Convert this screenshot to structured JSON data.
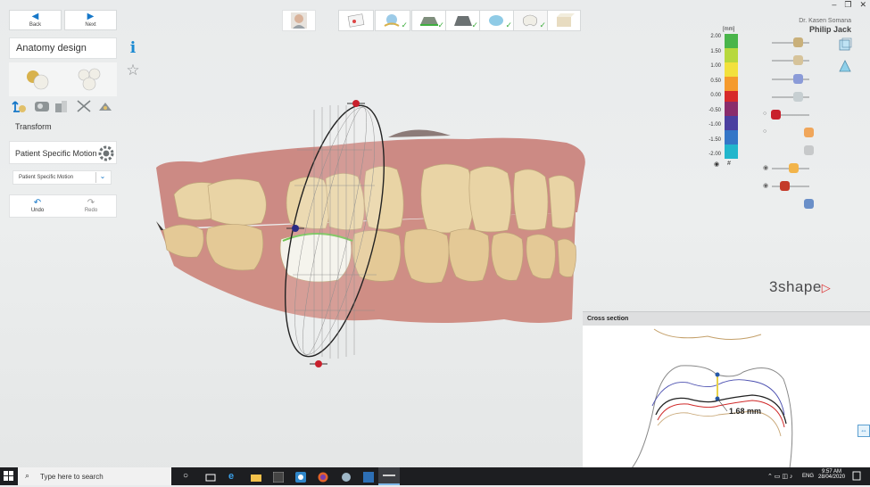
{
  "window": {
    "minimize": "–",
    "restore": "❐",
    "close": "✕"
  },
  "nav": {
    "back_label": "Back",
    "next_label": "Next"
  },
  "panel": {
    "title": "Anatomy design",
    "info_icon": "i",
    "transform_label": "Transform",
    "psm_label": "Patient Specific Motion",
    "psm_select_value": "Patient Specific Motion",
    "undo_label": "Undo",
    "redo_label": "Redo"
  },
  "header": {
    "doctor": "Dr. Kasen Somana",
    "patient": "Philip Jack",
    "brand": "3shape"
  },
  "scale": {
    "unit": "[mm]",
    "ticks": [
      "2.00",
      "1.50",
      "1.00",
      "0.50",
      "0.00",
      "-0.50",
      "-1.00",
      "-1.50",
      "-2.00"
    ],
    "hash_label": "#"
  },
  "cross_section": {
    "title": "Cross section",
    "measurement": "1.68 mm"
  },
  "taskbar": {
    "search_placeholder": "Type here to search",
    "language": "ENG",
    "time": "9:57 AM",
    "date": "28/04/2020"
  },
  "colors": {
    "accent": "#1677c8",
    "gum": "#cf8a83",
    "tooth": "#e8d3a8",
    "check": "#3fae3f",
    "taskbar": "#1d1e21"
  }
}
